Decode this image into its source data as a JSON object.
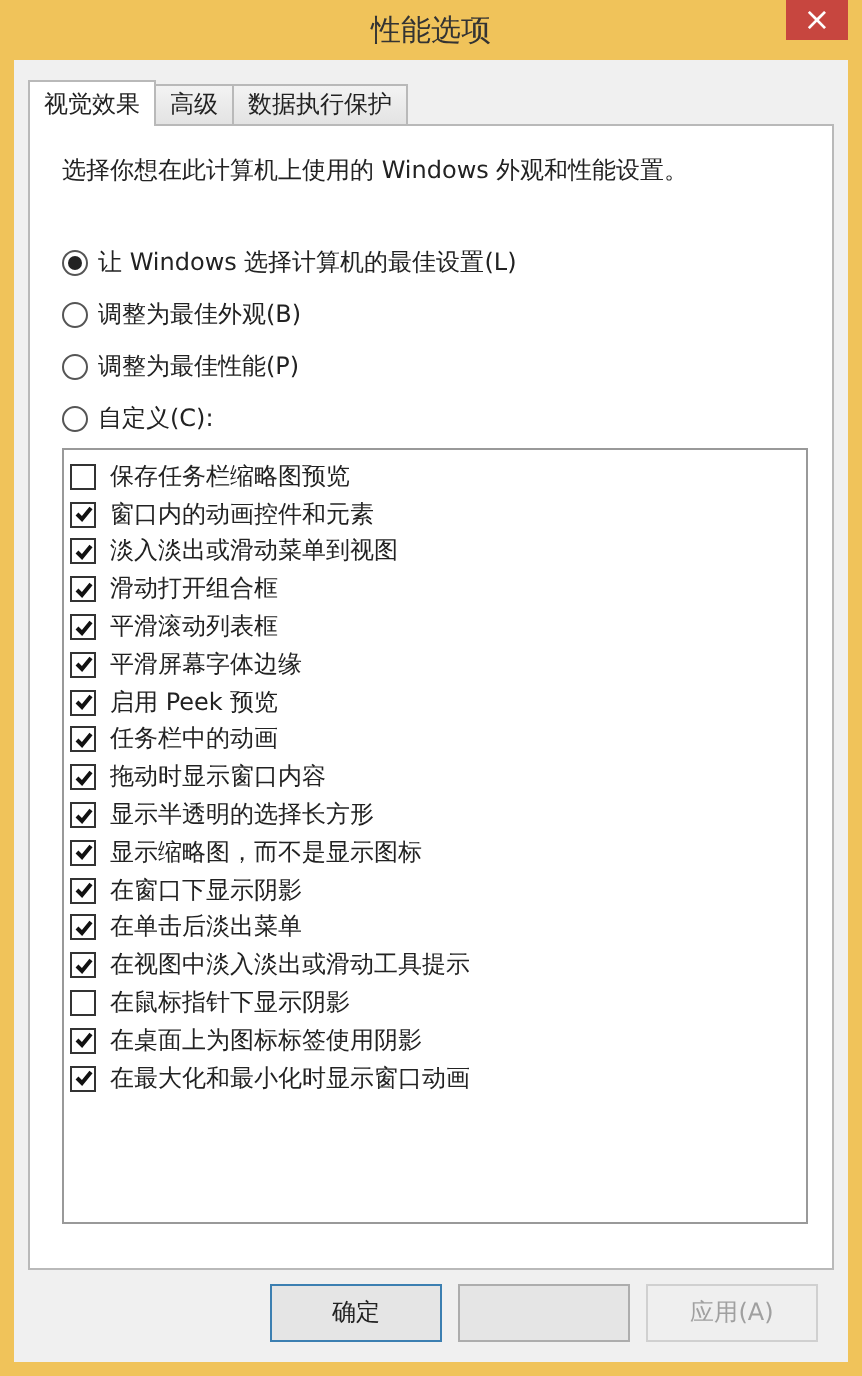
{
  "window": {
    "title": "性能选项",
    "close": "×"
  },
  "tabs": [
    {
      "label": "视觉效果",
      "selected": true
    },
    {
      "label": "高级",
      "selected": false
    },
    {
      "label": "数据执行保护",
      "selected": false
    }
  ],
  "intro": "选择你想在此计算机上使用的 Windows 外观和性能设置。",
  "radios": [
    {
      "label": "让 Windows 选择计算机的最佳设置(L)",
      "selected": true
    },
    {
      "label": "调整为最佳外观(B)",
      "selected": false
    },
    {
      "label": "调整为最佳性能(P)",
      "selected": false
    },
    {
      "label": "自定义(C):",
      "selected": false
    }
  ],
  "options": [
    {
      "label": "保存任务栏缩略图预览",
      "checked": false
    },
    {
      "label": "窗口内的动画控件和元素",
      "checked": true
    },
    {
      "label": "淡入淡出或滑动菜单到视图",
      "checked": true
    },
    {
      "label": "滑动打开组合框",
      "checked": true
    },
    {
      "label": "平滑滚动列表框",
      "checked": true
    },
    {
      "label": "平滑屏幕字体边缘",
      "checked": true
    },
    {
      "label": "启用 Peek 预览",
      "checked": true
    },
    {
      "label": "任务栏中的动画",
      "checked": true
    },
    {
      "label": "拖动时显示窗口内容",
      "checked": true
    },
    {
      "label": "显示半透明的选择长方形",
      "checked": true
    },
    {
      "label": "显示缩略图，而不是显示图标",
      "checked": true
    },
    {
      "label": "在窗口下显示阴影",
      "checked": true
    },
    {
      "label": "在单击后淡出菜单",
      "checked": true
    },
    {
      "label": "在视图中淡入淡出或滑动工具提示",
      "checked": true
    },
    {
      "label": "在鼠标指针下显示阴影",
      "checked": false
    },
    {
      "label": "在桌面上为图标标签使用阴影",
      "checked": true
    },
    {
      "label": "在最大化和最小化时显示窗口动画",
      "checked": true
    }
  ],
  "buttons": [
    {
      "label": "确定",
      "kind": "default",
      "disabled": false
    },
    {
      "kind": "blank",
      "disabled": false
    },
    {
      "label": "应用(A)",
      "kind": "normal",
      "disabled": true
    }
  ]
}
